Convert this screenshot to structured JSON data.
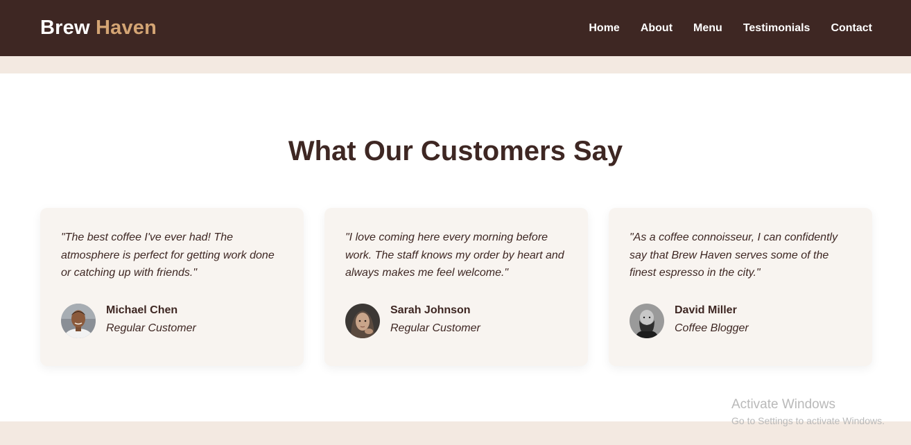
{
  "header": {
    "logo_part1": "Brew",
    "logo_part2": "Haven",
    "nav": [
      "Home",
      "About",
      "Menu",
      "Testimonials",
      "Contact"
    ]
  },
  "section": {
    "title": "What Our Customers Say"
  },
  "testimonials": [
    {
      "quote": "\"The best coffee I've ever had! The atmosphere is perfect for getting work done or catching up with friends.\"",
      "name": "Michael Chen",
      "role": "Regular Customer"
    },
    {
      "quote": "\"I love coming here every morning before work. The staff knows my order by heart and always makes me feel welcome.\"",
      "name": "Sarah Johnson",
      "role": "Regular Customer"
    },
    {
      "quote": "\"As a coffee connoisseur, I can confidently say that Brew Haven serves some of the finest espresso in the city.\"",
      "name": "David Miller",
      "role": "Coffee Blogger"
    }
  ],
  "watermark": {
    "line1": "Activate Windows",
    "line2": "Go to Settings to activate Windows."
  },
  "colors": {
    "header_bg": "#3e2723",
    "accent": "#d4a574",
    "card_bg": "#f8f4f0",
    "band_bg": "#f3e9e1"
  }
}
